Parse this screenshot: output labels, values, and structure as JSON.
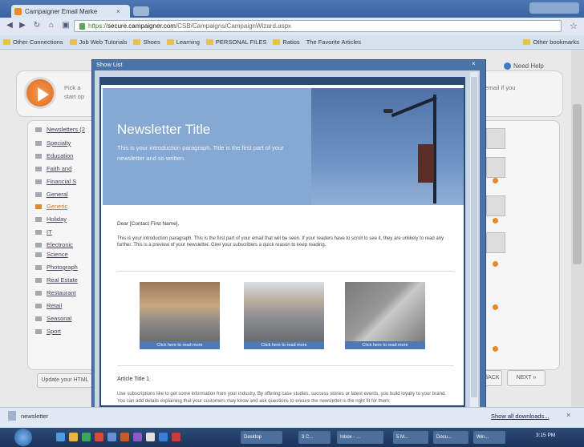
{
  "browser": {
    "tab_title": "Campaigner Email Marke",
    "tab_close": "×",
    "url_https": "https://",
    "url_host": "secure.campaigner.com",
    "url_path": "/CSB/Campaigns/CampaignWizard.aspx",
    "bookmarks": [
      "Other Connections",
      "Job Web Tutorials",
      "Shoes",
      "Learning",
      "PERSONAL FILES",
      "Ratios",
      "The Favorite Articles",
      "Other bookmarks"
    ]
  },
  "page": {
    "help_label": "Need Help",
    "step_left": "Pick a start op",
    "step_right": "ate email if you",
    "categories": [
      "Newsletters (2",
      "Specialty",
      "Education",
      "Faith and",
      "Financial S",
      "General",
      "Generic",
      "Holiday",
      "IT",
      "Electronic",
      "Science",
      "Photograph",
      "Real Estate",
      "Restaurant",
      "Retail",
      "Seasonal",
      "Sport"
    ],
    "update_btn": "Update your HTML",
    "back_btn": "BACK",
    "next_btn": "NEXT »"
  },
  "modal": {
    "title": "Show List",
    "close": "×",
    "newsletter": {
      "title": "Newsletter Title",
      "intro": "This is your introduction paragraph. Title is the first part of your newsletter and so written.",
      "greeting": "Dear [Contact First Name],",
      "body": "This is your introduction paragraph. This is the first part of your email that will be seen. If your readers have to scroll to see it, they are unlikely to read any further. This is a preview of your newsletter. Give your subscribers a quick reason to keep reading.",
      "captions": [
        "Click here to read more",
        "Click here to read more",
        "Click here to read more"
      ],
      "article_title": "Article Title 1",
      "article_text": "Use subscriptions like to get some information from your industry. By offering case studies, success stories or latest events, you build loyalty to your brand. You can add details explaining that your customers may know and ask questions to ensure the newsletter is the right fit for them."
    }
  },
  "statusbar": {
    "download_name": "newsletter",
    "show_all": "Show all downloads...",
    "close": "×"
  },
  "taskbar": {
    "tasks": [
      "Desktop",
      "3 C...",
      "Inbox - ...",
      "5 M...",
      "Docu...",
      "Win..."
    ],
    "clock": "3:15 PM"
  }
}
